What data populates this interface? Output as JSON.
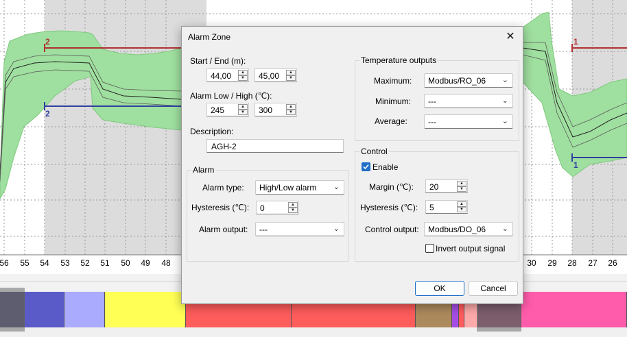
{
  "chart": {
    "axis_ticks": [
      "56",
      "55",
      "54",
      "53",
      "52",
      "51",
      "50",
      "49",
      "48",
      "30",
      "29",
      "28",
      "27",
      "26"
    ],
    "zone_labels": {
      "red_left": "2",
      "blue_left": "2",
      "red_right": "1",
      "blue_right": "1"
    },
    "colors": {
      "band": "#9fdf9f",
      "zone_shade": "#dcdcdc",
      "red_zone": "#b03030",
      "blue_zone": "#3040a0"
    }
  },
  "color_strip": {
    "segments": [
      "#4d4b73",
      "#5a5ac8",
      "#aaaaff",
      "#ffff55",
      "#ff5c5c",
      "#ff5c5c",
      "#ad8a5e",
      "#a64de6",
      "#ff5c5c",
      "#ffaaaa",
      "#8e4c6e",
      "#ff5cab"
    ]
  },
  "dialog": {
    "title": "Alarm Zone",
    "close_glyph": "✕",
    "start_end_label": "Start / End (m):",
    "start_value": "44,00",
    "end_value": "45,00",
    "alarm_lowhigh_label": "Alarm Low / High (℃):",
    "low_value": "245",
    "high_value": "300",
    "description_label": "Description:",
    "description_value": "AGH-2",
    "alarm_group": {
      "title": "Alarm",
      "type_label": "Alarm type:",
      "type_value": "High/Low alarm",
      "hysteresis_label": "Hysteresis (℃):",
      "hysteresis_value": "0",
      "output_label": "Alarm output:",
      "output_value": "---"
    },
    "temp_group": {
      "title": "Temperature outputs",
      "maximum_label": "Maximum:",
      "maximum_value": "Modbus/RO_06",
      "minimum_label": "Minimum:",
      "minimum_value": "---",
      "average_label": "Average:",
      "average_value": "---"
    },
    "control_group": {
      "title": "Control",
      "enable_label": "Enable",
      "enable_checked": true,
      "margin_label": "Margin (℃):",
      "margin_value": "20",
      "hysteresis_label": "Hysteresis (℃):",
      "hysteresis_value": "5",
      "output_label": "Control output:",
      "output_value": "Modbus/DO_06",
      "invert_label": "Invert output signal",
      "invert_checked": false
    },
    "ok_label": "OK",
    "cancel_label": "Cancel"
  }
}
